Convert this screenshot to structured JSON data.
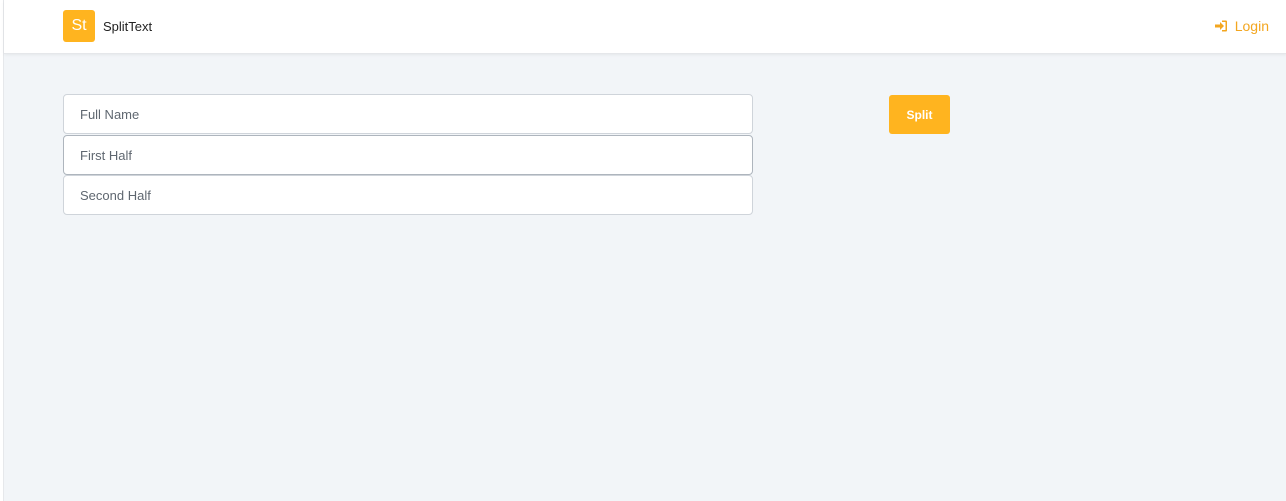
{
  "navbar": {
    "brand_logo_text": "St",
    "brand_name": "SplitText",
    "login_label": "Login",
    "login_icon": "sign-in-icon"
  },
  "form": {
    "full_name": {
      "placeholder": "Full Name",
      "value": ""
    },
    "first_half": {
      "placeholder": "First Half",
      "value": ""
    },
    "second_half": {
      "placeholder": "Second Half",
      "value": ""
    },
    "split_label": "Split"
  },
  "colors": {
    "accent": "#ffb41f",
    "link": "#f3a61f",
    "background": "#f2f5f8",
    "navbar": "#ffffff"
  }
}
